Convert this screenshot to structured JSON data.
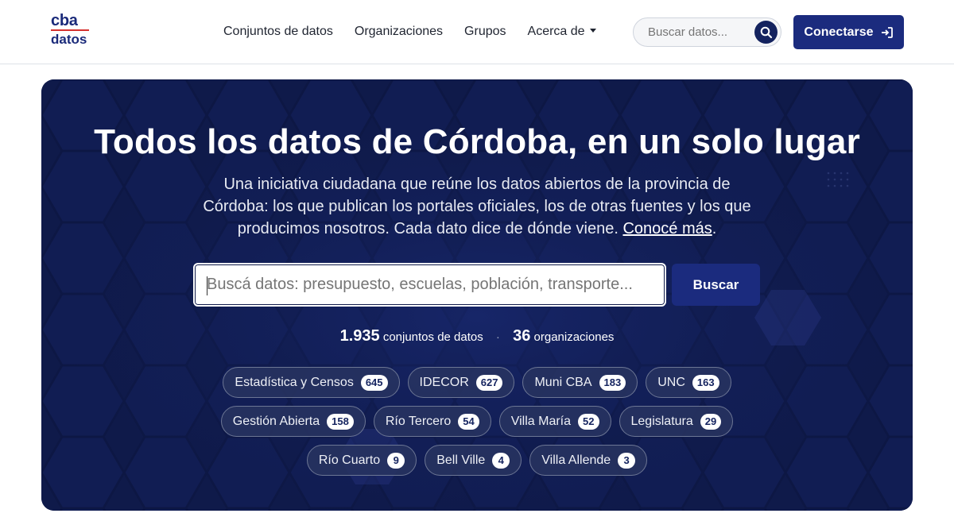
{
  "header": {
    "logo_top": "cba",
    "logo_bottom": "datos",
    "nav": {
      "datasets": "Conjuntos de datos",
      "organizations": "Organizaciones",
      "groups": "Grupos",
      "about": "Acerca de"
    },
    "search_placeholder": "Buscar datos...",
    "login_label": "Conectarse"
  },
  "hero": {
    "title": "Todos los datos de Córdoba, en un solo lugar",
    "subtitle_line1": "Una iniciativa ciudadana que reúne los datos abiertos de la provincia de",
    "subtitle_line2": "Córdoba: los que publican los portales oficiales, los de otras fuentes y los que",
    "subtitle_line3": "producimos nosotros. Cada dato dice de dónde viene.",
    "subtitle_link": "Conocé más",
    "subtitle_end": ".",
    "search_placeholder": "Buscá datos: presupuesto, escuelas, población, transporte...",
    "search_button": "Buscar",
    "stats": {
      "datasets_count": "1.935",
      "datasets_label": "conjuntos de datos",
      "separator": "·",
      "orgs_count": "36",
      "orgs_label": "organizaciones"
    },
    "chips_row1": [
      {
        "label": "Estadística y Censos",
        "count": "645"
      },
      {
        "label": "IDECOR",
        "count": "627"
      },
      {
        "label": "Muni CBA",
        "count": "183"
      },
      {
        "label": "UNC",
        "count": "163"
      }
    ],
    "chips_row2": [
      {
        "label": "Gestión Abierta",
        "count": "158"
      },
      {
        "label": "Río Tercero",
        "count": "54"
      },
      {
        "label": "Villa María",
        "count": "52"
      },
      {
        "label": "Legislatura",
        "count": "29"
      }
    ],
    "chips_row3": [
      {
        "label": "Río Cuarto",
        "count": "9"
      },
      {
        "label": "Bell Ville",
        "count": "4"
      },
      {
        "label": "Villa Allende",
        "count": "3"
      }
    ]
  },
  "colors": {
    "brand_navy": "#1b2b7e",
    "hero_bg": "#0f1a4a",
    "logo_red": "#d6322f"
  }
}
